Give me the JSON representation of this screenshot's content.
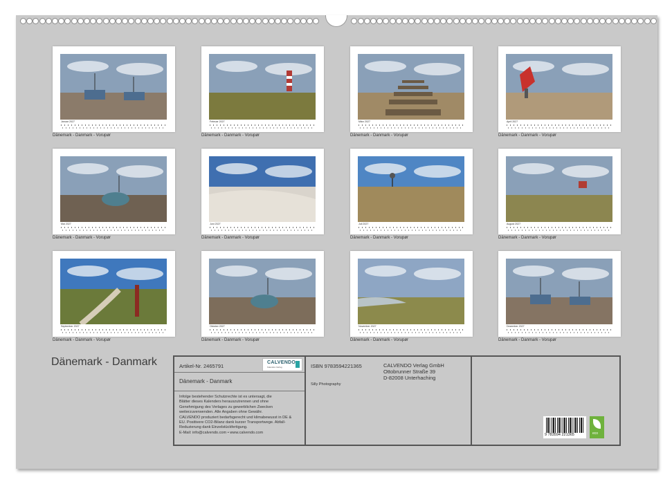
{
  "title": "Dänemark - Danmark",
  "months": [
    {
      "label": "Januar 2027",
      "caption": "Dänemark - Danmark - Vorupør",
      "scene": "boats"
    },
    {
      "label": "Februar 2027",
      "caption": "Dänemark - Danmark - Vorupør",
      "scene": "lighthouse"
    },
    {
      "label": "März 2027",
      "caption": "Dänemark - Danmark - Vorupør",
      "scene": "steps"
    },
    {
      "label": "April 2027",
      "caption": "Dänemark - Danmark - Vorupør",
      "scene": "buoy"
    },
    {
      "label": "Mai 2027",
      "caption": "Dänemark - Danmark - Vorupør",
      "scene": "boat-beach"
    },
    {
      "label": "Juni 2027",
      "caption": "Dänemark - Danmark - Vorupør",
      "scene": "sand"
    },
    {
      "label": "Juli 2027",
      "caption": "Dänemark - Danmark - Vorupør",
      "scene": "dunes-tree"
    },
    {
      "label": "August 2027",
      "caption": "Dänemark - Danmark - Vorupør",
      "scene": "dune-house"
    },
    {
      "label": "September 2027",
      "caption": "Dänemark - Danmark - Vorupør",
      "scene": "path-post"
    },
    {
      "label": "Oktober 2027",
      "caption": "Dänemark - Danmark - Vorupør",
      "scene": "single-boat"
    },
    {
      "label": "November 2027",
      "caption": "Dänemark - Danmark - Vorupør",
      "scene": "coast"
    },
    {
      "label": "Dezember 2027",
      "caption": "Dänemark - Danmark - Vorupør",
      "scene": "two-boats"
    }
  ],
  "info": {
    "article": "Artikel-Nr. 2465791",
    "logo_text": "CALVENDO",
    "logo_sub": "Kalender-Verlag",
    "subtitle": "Dänemark - Danmark",
    "legal": [
      "Infolge bestehender Schutzrechte ist es untersagt, die",
      "Blätter dieses Kalenders herauszutrennen und ohne",
      "Genehmigung des Verlages zu gewerblichen Zwecken",
      "weiterzuverwenden. Alle Angaben ohne Gewähr.",
      "CALVENDO produziert bedarfsgerecht und klimabewusst in DE &",
      "EU. Positivere CO2-Bilanz dank kurzer Transportwege. Abfall-",
      "Reduzierung dank Einzelstückfertigung.",
      "E-Mail: info@calvendo.com • www.calvendo.com"
    ],
    "isbn": "ISBN 9783594221365",
    "author": "Silly Photography",
    "publisher_lines": [
      "CALVENDO Verlag GmbH",
      "Ottobrunner Straße 39",
      "D-82008 Unterhaching"
    ],
    "barcode_number": "9 783594 221365",
    "eco_label": "eco"
  },
  "colors": {
    "sheet": "#c9c9c9",
    "accent": "#2a5f6d",
    "eco": "#6fb23d"
  }
}
